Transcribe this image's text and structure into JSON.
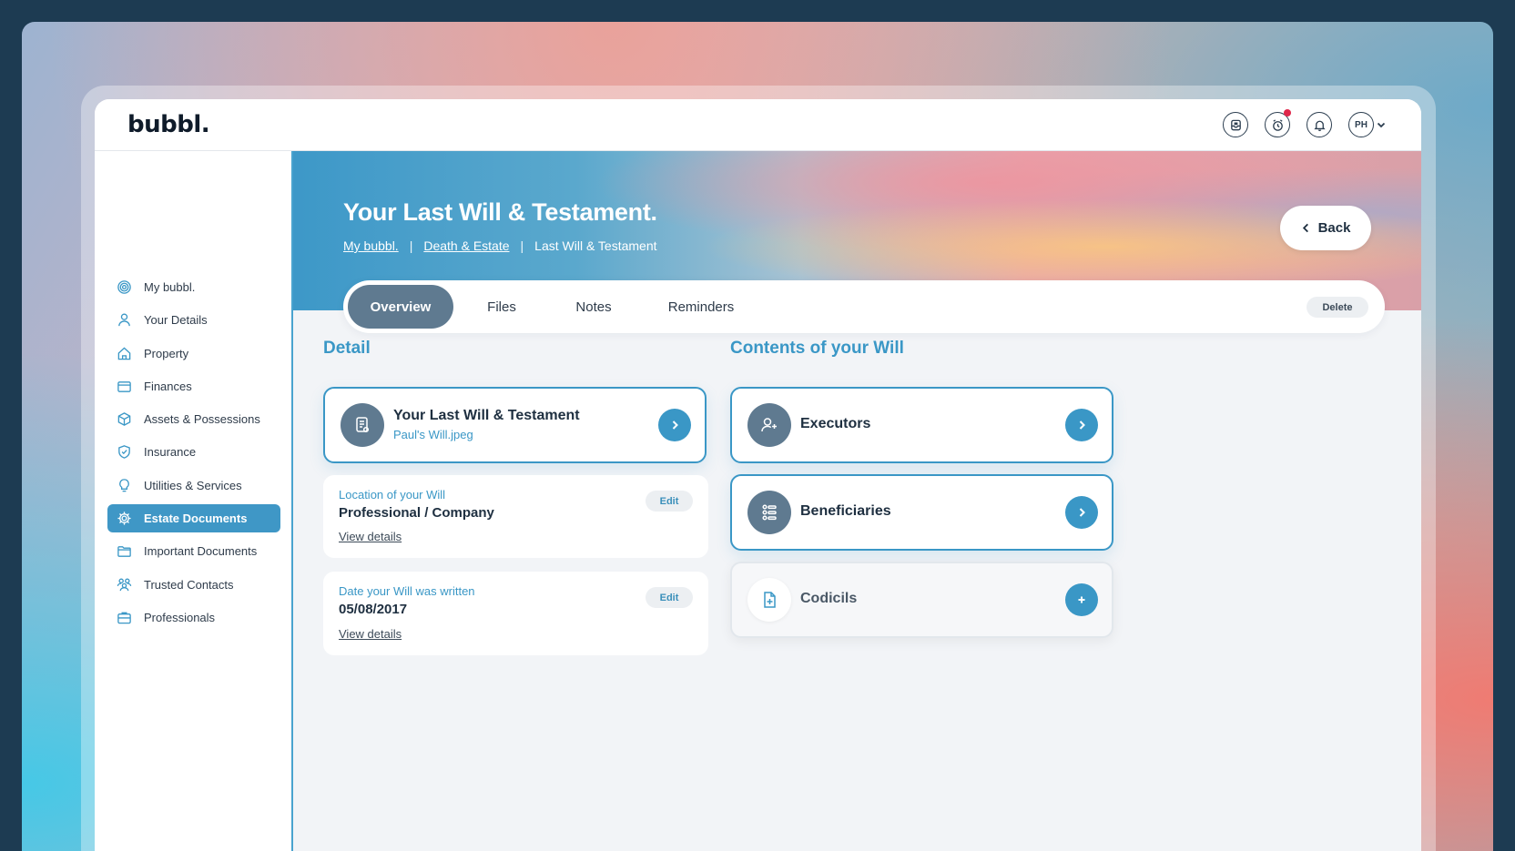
{
  "app": {
    "logo": "bubbl."
  },
  "topbar": {
    "icons": [
      "inbox-icon",
      "alarm-clock-icon",
      "bell-icon"
    ],
    "avatar_initials": "PH"
  },
  "sidebar": {
    "items": [
      {
        "label": "My bubbl.",
        "icon": "target-icon"
      },
      {
        "label": "Your Details",
        "icon": "user-icon"
      },
      {
        "label": "Property",
        "icon": "home-icon"
      },
      {
        "label": "Finances",
        "icon": "wallet-icon"
      },
      {
        "label": "Assets & Possessions",
        "icon": "box-icon"
      },
      {
        "label": "Insurance",
        "icon": "shield-icon"
      },
      {
        "label": "Utilities & Services",
        "icon": "lightbulb-icon"
      },
      {
        "label": "Estate Documents",
        "icon": "gear-icon",
        "active": true
      },
      {
        "label": "Important Documents",
        "icon": "folder-icon"
      },
      {
        "label": "Trusted Contacts",
        "icon": "people-icon"
      },
      {
        "label": "Professionals",
        "icon": "briefcase-icon"
      }
    ]
  },
  "hero": {
    "title": "Your Last Will & Testament.",
    "breadcrumb": [
      "My bubbl.",
      "Death & Estate",
      "Last Will & Testament"
    ],
    "separator": "|",
    "back_label": "Back"
  },
  "tabs": {
    "items": [
      "Overview",
      "Files",
      "Notes",
      "Reminders"
    ],
    "active": "Overview",
    "delete_label": "Delete"
  },
  "detail": {
    "title": "Detail",
    "will_card": {
      "title": "Your Last Will & Testament",
      "file": "Paul's Will.jpeg"
    },
    "location": {
      "label": "Location of your Will",
      "value": "Professional / Company",
      "link": "View details",
      "edit": "Edit"
    },
    "date": {
      "label": "Date your Will was written",
      "value": "05/08/2017",
      "link": "View details",
      "edit": "Edit"
    }
  },
  "contents": {
    "title": "Contents of your Will",
    "items": [
      {
        "label": "Executors",
        "icon": "user-plus-icon",
        "action": "chevron-right-icon"
      },
      {
        "label": "Beneficiaries",
        "icon": "list-people-icon",
        "action": "chevron-right-icon"
      },
      {
        "label": "Codicils",
        "icon": "file-plus-icon",
        "action": "plus-icon"
      }
    ]
  },
  "colors": {
    "accent": "#3a97c6",
    "active_tab": "#5f7a90",
    "text_dark": "#1e2f40",
    "notification": "#e0274a"
  }
}
